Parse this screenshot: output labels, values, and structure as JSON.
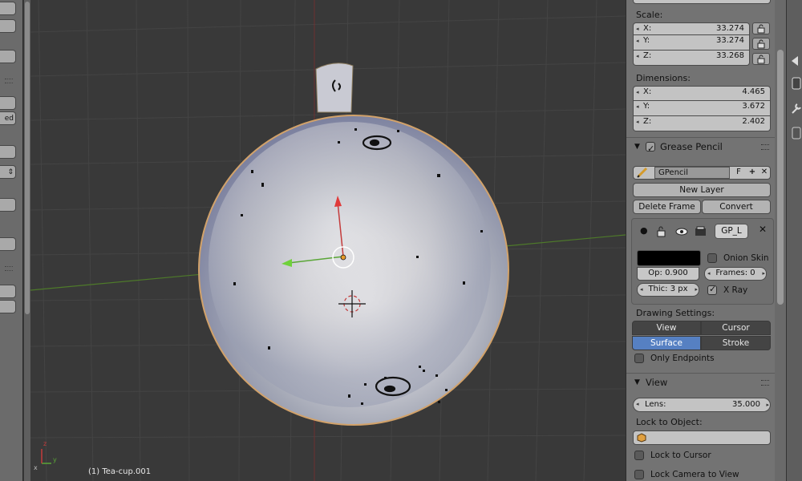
{
  "viewport": {
    "object_label": "(1) Tea-cup.001"
  },
  "left_toolbar": {
    "partial_labels": [
      "ed"
    ]
  },
  "transform": {
    "scale_label": "Scale:",
    "scale": [
      {
        "axis": "X:",
        "value": "33.274"
      },
      {
        "axis": "Y:",
        "value": "33.274"
      },
      {
        "axis": "Z:",
        "value": "33.268"
      }
    ],
    "dimensions_label": "Dimensions:",
    "dimensions": [
      {
        "axis": "X:",
        "value": "4.465"
      },
      {
        "axis": "Y:",
        "value": "3.672"
      },
      {
        "axis": "Z:",
        "value": "2.402"
      }
    ]
  },
  "grease_pencil": {
    "title": "Grease Pencil",
    "enabled": true,
    "datablock_name": "GPencil",
    "fake_user_label": "F",
    "new_layer_label": "New Layer",
    "delete_frame_label": "Delete Frame",
    "convert_label": "Convert",
    "layer_name": "GP_L",
    "onion_skin_label": "Onion Skin",
    "onion_skin_checked": false,
    "opacity_label": "Op: 0.900",
    "frames_label": "Frames: 0",
    "thickness_label": "Thic: 3 px",
    "xray_label": "X Ray",
    "xray_checked": true,
    "stroke_color": "#000000",
    "drawing_settings_label": "Drawing Settings:",
    "modes": [
      {
        "label": "View",
        "active": false
      },
      {
        "label": "Cursor",
        "active": false
      },
      {
        "label": "Surface",
        "active": true
      },
      {
        "label": "Stroke",
        "active": false
      }
    ],
    "only_endpoints_label": "Only Endpoints",
    "only_endpoints_checked": false
  },
  "view": {
    "title": "View",
    "lens_label": "Lens:",
    "lens_value": "35.000",
    "lock_to_object_label": "Lock to Object:",
    "lock_to_cursor_label": "Lock to Cursor",
    "lock_camera_label": "Lock Camera to View"
  },
  "colors": {
    "accent": "#5680c2",
    "panel_bg": "#737373",
    "viewport_bg": "#393939",
    "x_axis": "#c43c3c",
    "y_axis": "#5aa637"
  }
}
